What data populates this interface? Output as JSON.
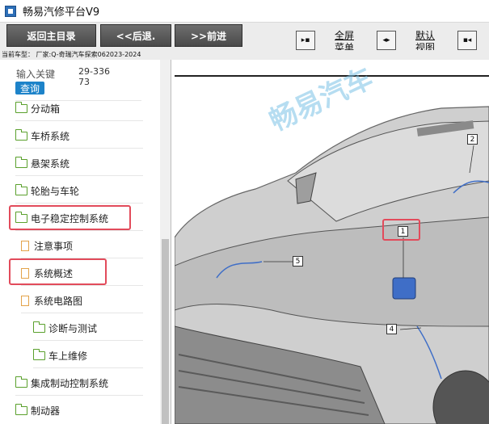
{
  "app": {
    "title": "畅易汽修平台V9"
  },
  "toolbar": {
    "back_home": "返回主目录",
    "back": "<<后退.",
    "forward": ">>前进",
    "fullscreen_line1": "全屏",
    "fullscreen_line2": "菜单",
    "default_line1": "默认",
    "default_line2": "视图"
  },
  "info": {
    "vehicle": "当前车型：  厂家:Q-奇瑞汽车探索062023-2024"
  },
  "search": {
    "label": "输入关键",
    "button": "查询",
    "value": "29-33673"
  },
  "tree": {
    "items": [
      {
        "label": "分动箱",
        "type": "folder"
      },
      {
        "label": "车桥系统",
        "type": "folder"
      },
      {
        "label": "悬架系统",
        "type": "folder"
      },
      {
        "label": "轮胎与车轮",
        "type": "folder"
      },
      {
        "label": "电子稳定控制系统",
        "type": "folder-open"
      },
      {
        "label": "注意事项",
        "type": "doc"
      },
      {
        "label": "系统概述",
        "type": "doc"
      },
      {
        "label": "系统电路图",
        "type": "doc"
      },
      {
        "label": "诊断与测试",
        "type": "folder"
      },
      {
        "label": "车上维修",
        "type": "folder"
      },
      {
        "label": "集成制动控制系统",
        "type": "folder"
      },
      {
        "label": "制动器",
        "type": "folder"
      }
    ]
  },
  "diagram": {
    "watermark": "畅易汽车",
    "callouts": [
      "1",
      "2",
      "4",
      "5"
    ]
  },
  "colors": {
    "accent": "#1d83c9",
    "highlight": "#e24b5b",
    "folder": "#5aa02c",
    "doc": "#e3a34a"
  }
}
